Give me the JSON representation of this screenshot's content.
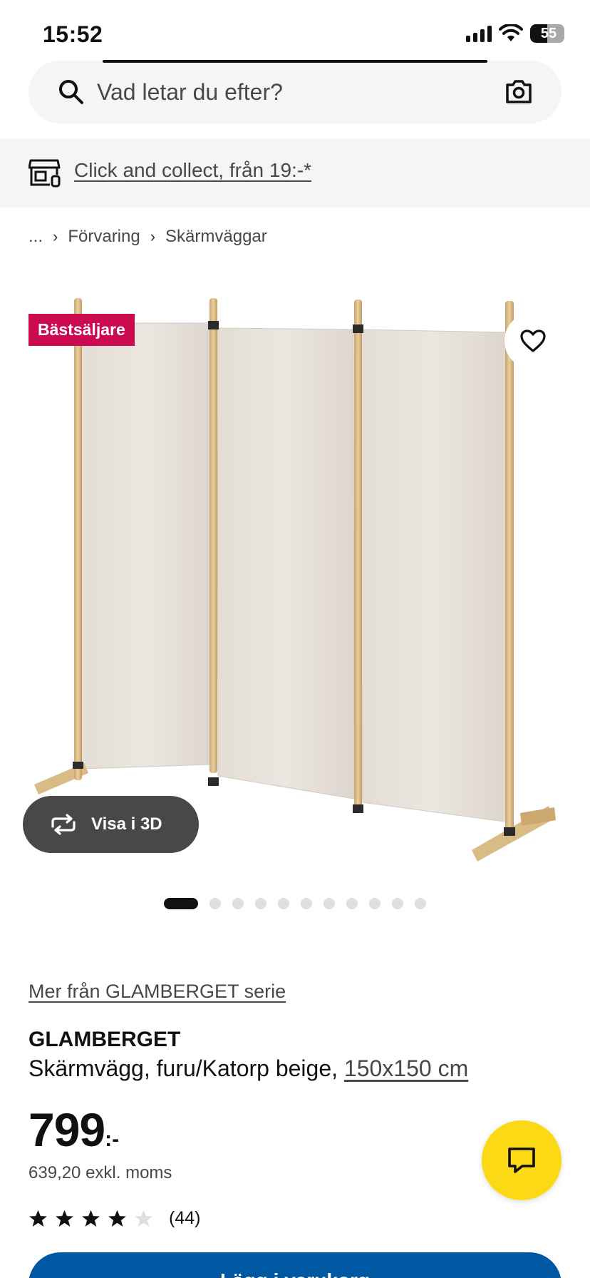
{
  "status_bar": {
    "time": "15:52",
    "battery": "55"
  },
  "search": {
    "placeholder": "Vad letar du efter?"
  },
  "banner": {
    "text": "Click and collect, från 19:-*"
  },
  "breadcrumb": {
    "ellipsis": "...",
    "items": [
      "Förvaring",
      "Skärmväggar"
    ]
  },
  "product": {
    "badge": "Bästsäljare",
    "view_3d_label": "Visa i 3D",
    "image_count": 12,
    "active_image_index": 0,
    "series_link": "Mer från GLAMBERGET serie",
    "name": "GLAMBERGET",
    "description": "Skärmvägg, furu/Katorp beige,",
    "size": "150x150 cm",
    "price": "799",
    "price_suffix": ":-",
    "price_ex_vat": "639,20 exkl. moms",
    "rating": 4,
    "rating_max": 5,
    "review_count": "(44)",
    "cart_label": "Lägg i varukorg"
  },
  "icons": {
    "search": "search-icon",
    "camera": "camera-icon",
    "store": "store-icon",
    "favourite": "heart-icon",
    "rotate": "rotate-3d-icon",
    "chat": "chat-icon"
  },
  "colors": {
    "badge": "#cc0a4f",
    "primary": "#0058a3",
    "chat": "#fbd914",
    "view3d": "#484848"
  }
}
